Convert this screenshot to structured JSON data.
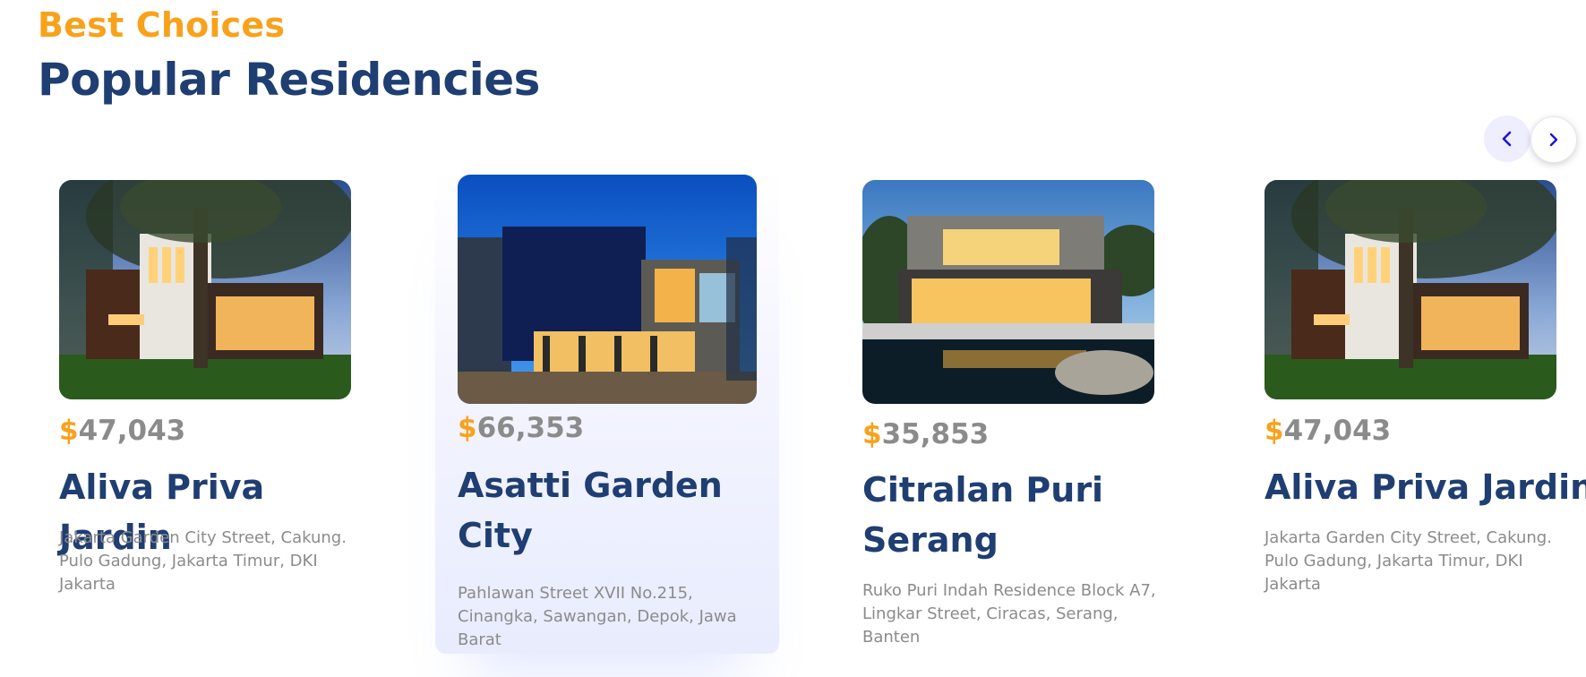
{
  "section": {
    "eyebrow": "Best Choices",
    "heading": "Popular Residencies"
  },
  "nav": {
    "prev_icon": "chevron-left-icon",
    "next_icon": "chevron-right-icon",
    "prev_label": "‹",
    "next_label": "›"
  },
  "colors": {
    "accent": "#f8a21c",
    "heading": "#1f3e72",
    "muted": "#8c8b8b",
    "nav_blue": "#1b16d6"
  },
  "residencies": [
    {
      "currency": "$",
      "price": "47,043",
      "name": "Aliva Priva Jardin",
      "address": "Jakarta Garden City Street, Cakung. Pulo Gadung, Jakarta Timur, DKI Jakarta"
    },
    {
      "currency": "$",
      "price": "66,353",
      "name": "Asatti Garden City",
      "address": "Pahlawan Street XVII No.215, Cinangka, Sawangan, Depok, Jawa Barat"
    },
    {
      "currency": "$",
      "price": "35,853",
      "name": "Citralan Puri Serang",
      "address": "Ruko Puri Indah Residence Block A7, Lingkar Street, Ciracas, Serang, Banten"
    },
    {
      "currency": "$",
      "price": "47,043",
      "name": "Aliva Priva Jardin",
      "address": "Jakarta Garden City Street, Cakung. Pulo Gadung, Jakarta Timur, DKI Jakarta"
    }
  ]
}
